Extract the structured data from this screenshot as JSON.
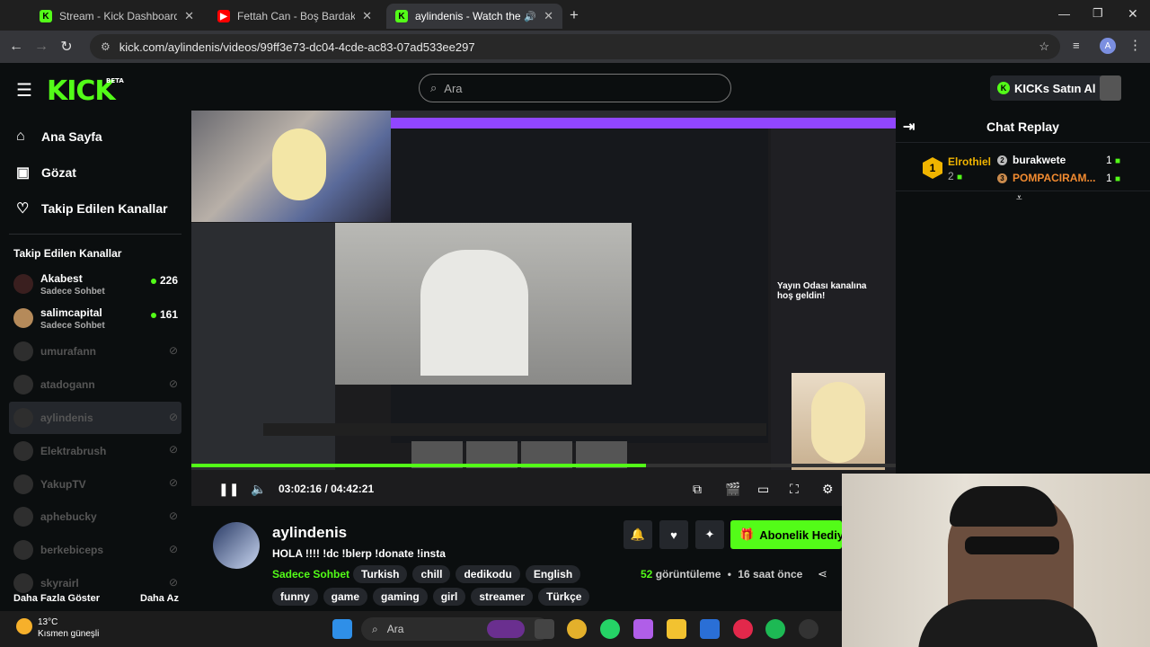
{
  "browser": {
    "tabs": [
      {
        "title": "Stream - Kick Dashboard",
        "color": "#53fc18",
        "fav": "K"
      },
      {
        "title": "Fettah Can - Boş Bardak - YouTube",
        "color": "#ff0000",
        "fav": "▶"
      },
      {
        "title": "aylindenis - Watch the VOD",
        "color": "#53fc18",
        "fav": "K"
      }
    ],
    "url": "kick.com/aylindenis/videos/99ff3e73-dc04-4cde-ac83-07ad533ee297"
  },
  "header": {
    "logo": "KICK",
    "beta": "BETA",
    "search_placeholder": "Ara",
    "kicks_button": "KICKs Satın Al"
  },
  "sidebar": {
    "nav": [
      {
        "label": "Ana Sayfa",
        "icon": "home-icon"
      },
      {
        "label": "Gözat",
        "icon": "browse-icon"
      },
      {
        "label": "Takip Edilen Kanallar",
        "icon": "heart-icon"
      }
    ],
    "following_heading": "Takip Edilen Kanallar",
    "channels": [
      {
        "name": "Akabest",
        "sub": "Sadece Sohbet",
        "viewers": "226",
        "live": true
      },
      {
        "name": "salimcapital",
        "sub": "Sadece Sohbet",
        "viewers": "161",
        "live": true
      },
      {
        "name": "umurafann",
        "live": false
      },
      {
        "name": "atadogann",
        "live": false
      },
      {
        "name": "aylindenis",
        "live": false,
        "selected": true
      },
      {
        "name": "Elektrabrush",
        "live": false
      },
      {
        "name": "YakupTV",
        "live": false
      },
      {
        "name": "aphebucky",
        "live": false
      },
      {
        "name": "berkebiceps",
        "live": false
      },
      {
        "name": "skyrairl",
        "live": false
      }
    ],
    "show_more": "Daha Fazla Göster",
    "show_less": "Daha Az"
  },
  "player": {
    "current_time": "03:02:16",
    "separator": "/",
    "duration": "04:42:21",
    "progress": 0.645,
    "overlay_welcome": "Yayın Odası kanalına hoş geldin!"
  },
  "chat": {
    "title": "Chat Replay",
    "leaderboard": {
      "first": {
        "rank": "1",
        "name": "Elrothiel",
        "count": "2"
      },
      "second": {
        "rank": "2",
        "name": "burakwete",
        "count": "1"
      },
      "third": {
        "rank": "3",
        "name": "POMPACIRAM...",
        "count": "1"
      }
    }
  },
  "stream_info": {
    "channel": "aylindenis",
    "title": "HOLA !!!! !dc !blerp !donate !insta",
    "category": "Sadece Sohbet",
    "tags_row1": [
      "Turkish",
      "chill",
      "dedikodu",
      "English"
    ],
    "tags_row2": [
      "funny",
      "game",
      "gaming",
      "girl",
      "streamer",
      "Türkçe"
    ],
    "subscribe_button": "Abonelik Hediye",
    "views_count": "52",
    "views_label": "görüntüleme",
    "dot": "•",
    "ago": "16 saat önce"
  },
  "taskbar": {
    "temperature": "13°C",
    "weather": "Kısmen güneşli",
    "search": "Ara"
  }
}
